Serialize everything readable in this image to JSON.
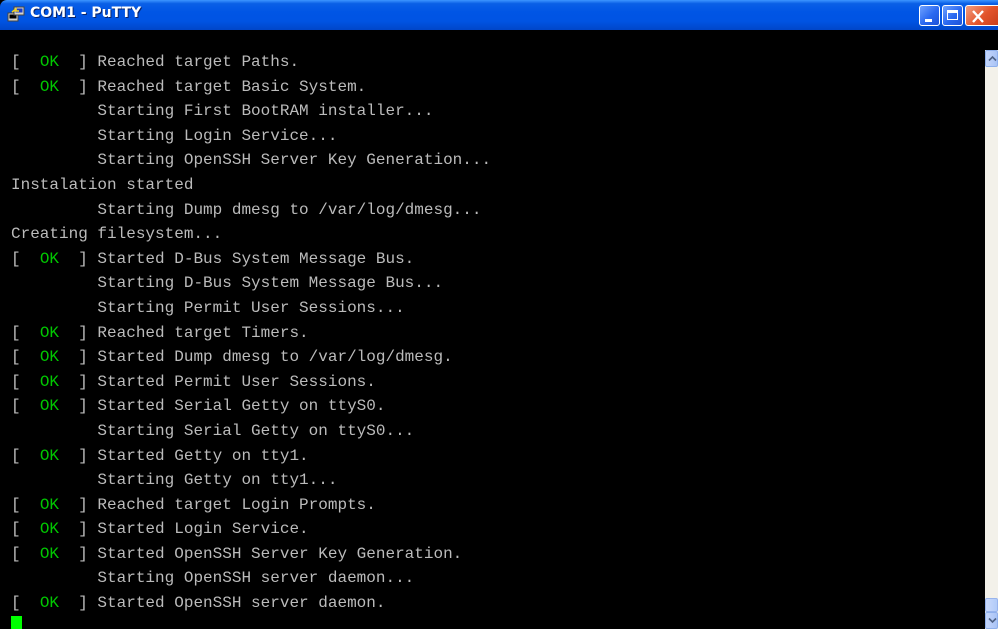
{
  "window": {
    "title": "COM1 - PuTTY",
    "icon": "putty-icon"
  },
  "colors": {
    "titlebar": "#0054e3",
    "terminal_bg": "#000000",
    "text": "#bbbbbb",
    "ok": "#00c800",
    "cursor": "#00ff00"
  },
  "terminal": {
    "lines": [
      {
        "ok": true,
        "text": "Reached target Paths."
      },
      {
        "ok": true,
        "text": "Reached target Basic System."
      },
      {
        "ok": false,
        "indent": true,
        "text": "Starting First BootRAM installer..."
      },
      {
        "ok": false,
        "indent": true,
        "text": "Starting Login Service..."
      },
      {
        "ok": false,
        "indent": true,
        "text": "Starting OpenSSH Server Key Generation..."
      },
      {
        "ok": false,
        "indent": false,
        "text": "Instalation started"
      },
      {
        "ok": false,
        "indent": true,
        "text": "Starting Dump dmesg to /var/log/dmesg..."
      },
      {
        "ok": false,
        "indent": false,
        "text": "Creating filesystem..."
      },
      {
        "ok": true,
        "text": "Started D-Bus System Message Bus."
      },
      {
        "ok": false,
        "indent": true,
        "text": "Starting D-Bus System Message Bus..."
      },
      {
        "ok": false,
        "indent": true,
        "text": "Starting Permit User Sessions..."
      },
      {
        "ok": true,
        "text": "Reached target Timers."
      },
      {
        "ok": true,
        "text": "Started Dump dmesg to /var/log/dmesg."
      },
      {
        "ok": true,
        "text": "Started Permit User Sessions."
      },
      {
        "ok": true,
        "text": "Started Serial Getty on ttyS0."
      },
      {
        "ok": false,
        "indent": true,
        "text": "Starting Serial Getty on ttyS0..."
      },
      {
        "ok": true,
        "text": "Started Getty on tty1."
      },
      {
        "ok": false,
        "indent": true,
        "text": "Starting Getty on tty1..."
      },
      {
        "ok": true,
        "text": "Reached target Login Prompts."
      },
      {
        "ok": true,
        "text": "Started Login Service."
      },
      {
        "ok": true,
        "text": "Started OpenSSH Server Key Generation."
      },
      {
        "ok": false,
        "indent": true,
        "text": "Starting OpenSSH server daemon..."
      },
      {
        "ok": true,
        "text": "Started OpenSSH server daemon."
      }
    ],
    "ok_label": "OK"
  }
}
